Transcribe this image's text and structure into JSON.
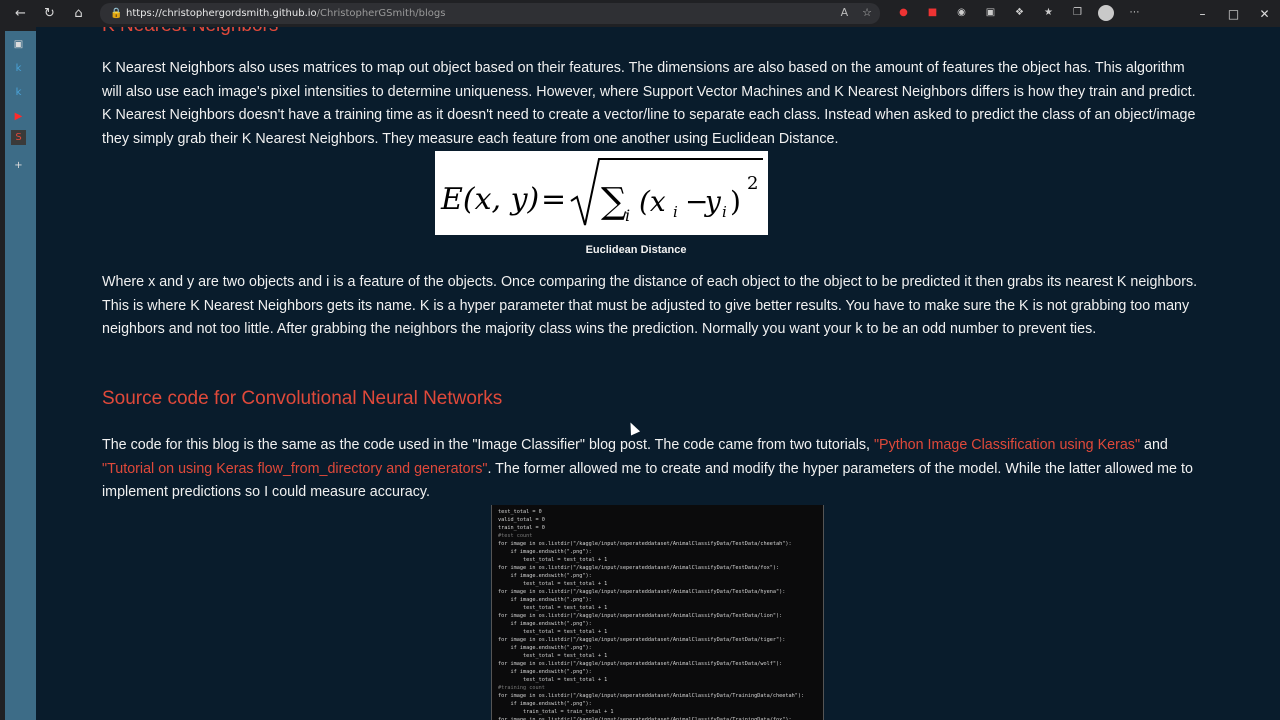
{
  "browser": {
    "url_host": "https://christophergordsmith.github.io",
    "url_path": "/ChristopherGSmith/blogs",
    "nav_icons": [
      "back-icon",
      "refresh-icon",
      "home-icon"
    ],
    "window_controls": [
      "minimize-icon",
      "maximize-icon",
      "close-icon"
    ]
  },
  "page": {
    "section1_heading": "K Nearest Neighbors",
    "para1": "K Nearest Neighbors also uses matrices to map out object based on their features. The dimensions are also based on the amount of features the object has. This algorithm will also use each image's pixel intensities to determine uniqueness. However, where Support Vector Machines and K Nearest Neighbors differs is how they train and predict. K Nearest Neighbors doesn't have a training time as it doesn't need to create a vector/line to separate each class. Instead when asked to predict the class of an object/image they simply grab their K Nearest Neighbors. They measure each feature from one another using Euclidean Distance.",
    "formula_caption": "Euclidean Distance",
    "para2": "Where x and y are two objects and i is a feature of the objects. Once comparing the distance of each object to the object to be predicted it then grabs its nearest K neighbors. This is where K Nearest Neighbors gets its name. K is a hyper parameter that must be adjusted to give better results. You have to make sure the K is not grabbing too many neighbors and not too little. After grabbing the neighbors the majority class wins the prediction. Normally you want your k to be an odd number to prevent ties.",
    "section2_heading": "Source code for Convolutional Neural Networks",
    "para3_a": "The code for this blog is the same as the code used in the \"Image Classifier\" blog post. The code came from two tutorials, ",
    "link1": "\"Python Image Classification using Keras\"",
    "para3_b": " and ",
    "link2": "\"Tutorial on using Keras flow_from_directory and generators\"",
    "para3_c": ". The former allowed me to create and modify the hyper parameters of the model. While the latter allowed me to implement predictions so I could measure accuracy."
  },
  "code_lines": [
    "test_total = 0",
    "valid_total = 0",
    "train_total = 0",
    "#test count",
    "for image in os.listdir(\"/kaggle/input/seperateddataset/AnimalClassifyData/TestData/cheetah\"):",
    "    if image.endswith(\".png\"):",
    "        test_total = test_total + 1",
    "for image in os.listdir(\"/kaggle/input/seperateddataset/AnimalClassifyData/TestData/fox\"):",
    "    if image.endswith(\".png\"):",
    "        test_total = test_total + 1",
    "for image in os.listdir(\"/kaggle/input/seperateddataset/AnimalClassifyData/TestData/hyena\"):",
    "    if image.endswith(\".png\"):",
    "        test_total = test_total + 1",
    "for image in os.listdir(\"/kaggle/input/seperateddataset/AnimalClassifyData/TestData/lion\"):",
    "    if image.endswith(\".png\"):",
    "        test_total = test_total + 1",
    "for image in os.listdir(\"/kaggle/input/seperateddataset/AnimalClassifyData/TestData/tiger\"):",
    "    if image.endswith(\".png\"):",
    "        test_total = test_total + 1",
    "for image in os.listdir(\"/kaggle/input/seperateddataset/AnimalClassifyData/TestData/wolf\"):",
    "    if image.endswith(\".png\"):",
    "        test_total = test_total + 1",
    "#training count",
    "for image in os.listdir(\"/kaggle/input/seperateddataset/AnimalClassifyData/TrainingData/cheetah\"):",
    "    if image.endswith(\".png\"):",
    "        train_total = train_total + 1",
    "for image in os.listdir(\"/kaggle/input/seperateddataset/AnimalClassifyData/TrainingData/fox\"):"
  ]
}
